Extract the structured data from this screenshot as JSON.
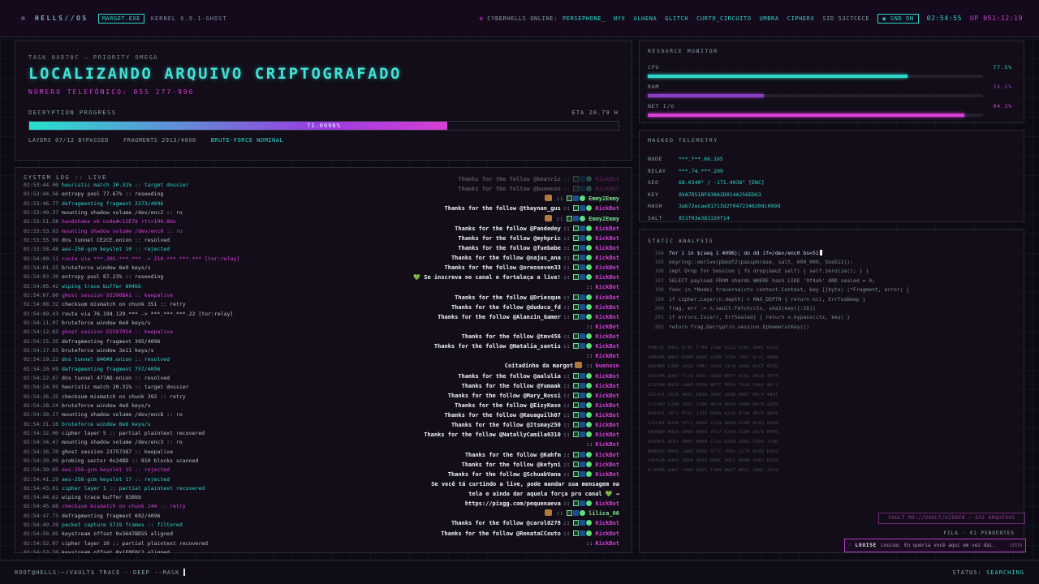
{
  "topbar": {
    "brand": "HELLS//OS",
    "tag": "MARGOT.EXE",
    "kernel": "KERNEL 6.9.1-GHOST",
    "online_label": "CYBERHELLS ONLINE:",
    "users": [
      "PERSEPHONE_",
      "NYX",
      "ALHENA",
      "GLITCH",
      "CURTO_CIRCUITO",
      "UMBRA",
      "CIPHERX"
    ],
    "sid": "SID 53C7CECE",
    "snd": "SND ON",
    "time": "02:54:55",
    "uptime": "UP 051:12:19"
  },
  "task": {
    "label": "TASK 0XD70C — PRIORITY OMEGA",
    "title": "LOCALIZANDO ARQUIVO CRIPTOGRAFADO",
    "phone": "NÚMERO TELEFÔNICO: 055 277-996",
    "progress_label": "DECRYPTION PROGRESS",
    "eta": "ETA 20.79 H",
    "progress": 0.71,
    "progress_text": "71.0096%",
    "layers": "LAYERS 07/12 BYPASSED",
    "fragments": "FRAGMENTS 2913/4096",
    "bruteforce": "BRUTE-FORCE NOMINAL"
  },
  "resources": {
    "title": "RESOURCE MONITOR",
    "items": [
      {
        "label": "CPU",
        "value": "77.5%",
        "fraction": 0.775,
        "color": "#2fd7c7"
      },
      {
        "label": "RAM",
        "value": "34.5%",
        "fraction": 0.345,
        "color": "#8b3fc0"
      },
      {
        "label": "NET I/O",
        "value": "94.3%",
        "fraction": 0.943,
        "color": "#d640d6"
      }
    ]
  },
  "telemetry": {
    "title": "MASKED TELEMETRY",
    "rows": [
      {
        "k": "NODE",
        "v": "***.***.66.165"
      },
      {
        "k": "RELAY",
        "v": "***.74.***.209"
      },
      {
        "k": "GEO",
        "v": "68.0340° / -171.4938° [ENC]"
      },
      {
        "k": "KEY",
        "v": "0XA7D51BF838A2D014A256ED63"
      },
      {
        "k": "HASH",
        "v": "3ab72ecae81713d2f047234620dc099d"
      },
      {
        "k": "SALT",
        "v": "851f03e381320f14"
      }
    ]
  },
  "analysis": {
    "title": "STATIC ANALYSIS",
    "code": [
      {
        "n": "194",
        "s": "for i in $(seq 1 4096); do dd if=/dev/enc0 bs=51",
        "hl": true
      },
      {
        "n": "195",
        "s": "keyring::derive(pbkdf2(passphrase, salt, 600_000, Sha512));"
      },
      {
        "n": "196",
        "s": "impl Drop for Session { fn drop(&mut self) { self.zeroize(); } }"
      },
      {
        "n": "197",
        "s": "SELECT payload FROM shards WHERE hash LIKE '9f4a%' AND sealed = 0;"
      },
      {
        "n": "198",
        "s": "func (n *Node) traverse(ctx context.Context, key []byte) (*Fragment, error) {"
      },
      {
        "n": "199",
        "s": "if cipher.Layer(n.depth) > MAX_DEPTH { return nil, ErrTooDeep }"
      },
      {
        "n": "200",
        "s": "frag, err := n.vault.Fetch(ctx, sha3(key)[:16])"
      },
      {
        "n": "201",
        "s": "if errors.Is(err, ErrSealed) { return n.bypass(ctx, key) }"
      },
      {
        "n": "202",
        "s": "return frag.Decrypt(n.session.EphemeralKey())"
      }
    ],
    "hex": [
      "994C1F b9e1 d747 f744 75ab 6c22 03b1 36ec e143",
      "34A48A 60e3 b990 ba0d 229d 1c0a f4e7 a77c 4668",
      "A658BA c3e0 342a 7d47 c9a4 11c8 3e6a d3cf 43fb",
      "56559A e56f f77d 8457 da6b b0ff dc82 2618 f9f4",
      "E32F64 8a29 1abd 9c66 a4ff 4056 fe2a 14e1 ae77",
      "282701 c639 ae02 b61e 36bc 1edb 48ef 0473 44df",
      "27c509 c2ad fb3c 3fd6 087a 903e 346d be7d 2ac9",
      "B55501 70f1 0f22 1732 ba45 a376 0756 4b19 ab01",
      "12CCB1 e33e 5f71 ab0e 752a aead 5c48 ecd3 e144",
      "E6D6D0 0858 a4e4 89ea 7937 9254 b1e6 3a7b 09fb",
      "9569F4 afb7 40df 00d4 cf2c d388 3865 f893 7c0b",
      "AD8D55 d095 1abd 036b 5ffc 2085 12f0 0c95 b562",
      "E8F82A ea03 3a54 861e ba0c adc1 8ee6 2563 bc03",
      "87399A ea8f 74a9 2e55 f38d d62f 002c 388c 12ca"
    ]
  },
  "vault": "VAULT MS://VAULT/HIDDEN — 032 ARQUIVOS",
  "fila": "FILA · 01 PENDENTES",
  "louise": {
    "name": "LOUISE",
    "message": "Louise: Eu queria você aqui em vez dai.",
    "state": "VISTO"
  },
  "syslog": {
    "title": "SYSTEM LOG :: LIVE",
    "rows": [
      {
        "t": "02:53:44.00",
        "m": "heuristic match 20.31% :: target dossier",
        "c": "cyan"
      },
      {
        "t": "02:53:44.56",
        "m": "entropy pool 77.67% :: reseeding",
        "c": "norm"
      },
      {
        "t": "02:53:46.77",
        "m": "defragmenting fragment 2373/4096",
        "c": "cyan"
      },
      {
        "t": "02:53:49.37",
        "m": "mounting shadow volume /dev/enc2 :: ro",
        "c": "norm"
      },
      {
        "t": "02:53:51.58",
        "m": "handshake ok node#c12E78 rtt=190.8ms",
        "c": "mag"
      },
      {
        "t": "02:53:53.93",
        "m": "mounting shadow volume /dev/enc0 :: ro",
        "c": "mag"
      },
      {
        "t": "02:53:55.99",
        "m": "dns tunnel CE2CE.onion :: resolved",
        "c": "norm"
      },
      {
        "t": "02:53:58.48",
        "m": "aes-256-gcm keyslot 10 :: rejected",
        "c": "cyan"
      },
      {
        "t": "02:54:00.11",
        "m": "route via ***.205.***.*** -> 210.***.***.*** [tor:relay]",
        "c": "mag"
      },
      {
        "t": "02:54:01.55",
        "m": "bruteforce window 8e9 keys/s",
        "c": "norm"
      },
      {
        "t": "02:54:03.39",
        "m": "entropy pool 87.23% :: reseeding",
        "c": "norm"
      },
      {
        "t": "02:54:05.42",
        "m": "wiping trace buffer 894kb",
        "c": "cyan"
      },
      {
        "t": "02:54:07.60",
        "m": "ghost session 93398BA1 :: keepalive",
        "c": "mag"
      },
      {
        "t": "02:54:08.32",
        "m": "checksum mismatch on chunk 351 :: retry",
        "c": "norm"
      },
      {
        "t": "02:54:09.43",
        "m": "route via 76.194.129.*** -> ***.***.***.22 [tor:relay]",
        "c": "norm"
      },
      {
        "t": "02:54:11.07",
        "m": "bruteforce window 6e8 keys/s",
        "c": "norm"
      },
      {
        "t": "02:54:12.83",
        "m": "ghost session E5597954 :: keepalive",
        "c": "mag"
      },
      {
        "t": "02:54:15.35",
        "m": "defragmenting fragment 395/4096",
        "c": "norm"
      },
      {
        "t": "02:54:17.85",
        "m": "bruteforce window 3e11 keys/s",
        "c": "norm"
      },
      {
        "t": "02:54:19.22",
        "m": "dns tunnel 840A9.onion :: resolved",
        "c": "cyan"
      },
      {
        "t": "02:54:20.69",
        "m": "defragmenting fragment 757/4096",
        "c": "cyan"
      },
      {
        "t": "02:54:22.87",
        "m": "dns tunnel 477AD.onion :: resolved",
        "c": "norm"
      },
      {
        "t": "02:54:24.95",
        "m": "heuristic match 20.31% :: target dossier",
        "c": "norm"
      },
      {
        "t": "02:54:26.35",
        "m": "checksum mismatch on chunk 392 :: retry",
        "c": "norm"
      },
      {
        "t": "02:54:28.24",
        "m": "bruteforce window 4e8 keys/s",
        "c": "norm"
      },
      {
        "t": "02:54:30.17",
        "m": "mounting shadow volume /dev/enc8 :: ro",
        "c": "norm"
      },
      {
        "t": "02:54:31.16",
        "m": "bruteforce window 8e6 keys/s",
        "c": "cyan"
      },
      {
        "t": "02:54:32.00",
        "m": "cipher layer 5 :: partial plaintext recovered",
        "c": "norm"
      },
      {
        "t": "02:54:34.47",
        "m": "mounting shadow volume /dev/enc3 :: ro",
        "c": "norm"
      },
      {
        "t": "02:54:36.70",
        "m": "ghost session 23757387 :: keepalive",
        "c": "norm"
      },
      {
        "t": "02:54:39.09",
        "m": "probing sector 0x248D :: 810 blocks scanned",
        "c": "norm"
      },
      {
        "t": "02:54:39.85",
        "m": "aes-256-gcm keyslot 15 :: rejected",
        "c": "mag"
      },
      {
        "t": "02:54:41.29",
        "m": "aes-256-gcm keyslot 17 :: rejected",
        "c": "cyan"
      },
      {
        "t": "02:54:43.01",
        "m": "cipher layer 1 :: partial plaintext recovered",
        "c": "cyan"
      },
      {
        "t": "02:54:44.62",
        "m": "wiping trace buffer 838kb",
        "c": "norm"
      },
      {
        "t": "02:54:45.68",
        "m": "checksum mismatch on chunk 244 :: retry",
        "c": "mag"
      },
      {
        "t": "02:54:47.73",
        "m": "defragmenting fragment 692/4096",
        "c": "norm"
      },
      {
        "t": "02:54:49.29",
        "m": "packet capture 5719 frames :: filtered",
        "c": "cyan"
      },
      {
        "t": "02:54:50.85",
        "m": "keystream offset 0x3647BD55 aligned",
        "c": "norm"
      },
      {
        "t": "02:54:52.07",
        "m": "cipher layer 10 :: partial plaintext recovered",
        "c": "norm"
      },
      {
        "t": "02:54:53.70",
        "m": "keystream offset 0x1F0E0C2 aligned",
        "c": "norm"
      }
    ]
  },
  "chat": {
    "rows": [
      {
        "text": "Thanks for the follow @beatriz",
        "user": "KickBot",
        "badges": true,
        "fade": true
      },
      {
        "text": "Thanks for the follow @buenosn",
        "user": "KickBot",
        "badges": true,
        "fade": true
      },
      {
        "text": "",
        "user": "Emmy2Emmy",
        "emoji": true,
        "green": true
      },
      {
        "text": "Thanks for the follow @thaynan_gus",
        "user": "KickBot",
        "badges": true
      },
      {
        "text": "",
        "user": "Emmy2Emmy",
        "emoji": true,
        "green": true
      },
      {
        "text": "Thanks for the follow @Pandedey",
        "user": "KickBot",
        "badges": true
      },
      {
        "text": "Thanks for the follow @myhpric",
        "user": "KickBot",
        "badges": true
      },
      {
        "text": "Thanks for the follow @fuebabe",
        "user": "KickBot",
        "badges": true
      },
      {
        "text": "Thanks for the follow @najux_ana",
        "user": "KickBot",
        "badges": true
      },
      {
        "text": "Thanks for the follow @oreoseven33",
        "user": "KickBot",
        "badges": true
      },
      {
        "text": "💚 Se inscreva no canal e fortaleça a live!",
        "user": "KickBot",
        "badges": true
      },
      {
        "text": "",
        "user": "KickBot"
      },
      {
        "text": "Thanks for the follow @Driesque",
        "user": "KickBot",
        "badges": true
      },
      {
        "text": "Thanks for the follow @duduca_fd",
        "user": "KickBot",
        "badges": true
      },
      {
        "text": "Thanks for the follow @Alanzin_Gamer",
        "user": "KickBot",
        "badges": true
      },
      {
        "text": "",
        "user": "KickBot"
      },
      {
        "text": "Thanks for the follow @tmv456",
        "user": "KickBot",
        "badges": true
      },
      {
        "text": "Thanks for the follow @Natalia_santis",
        "user": "KickBot",
        "badges": true
      },
      {
        "text": "",
        "user": "KickBot"
      },
      {
        "text": "Coitadinha da margot",
        "user": "buenosn",
        "emoji": true
      },
      {
        "text": "Thanks for the follow @aalulia",
        "user": "KickBot",
        "badges": true
      },
      {
        "text": "Thanks for the follow @Yumaak",
        "user": "KickBot",
        "badges": true
      },
      {
        "text": "Thanks for the follow @Mary_Rossi",
        "user": "KickBot",
        "badges": true
      },
      {
        "text": "Thanks for the follow @EizyKase",
        "user": "KickBot",
        "badges": true
      },
      {
        "text": "Thanks for the follow @Kauaguilh07",
        "user": "KickBot",
        "badges": true
      },
      {
        "text": "Thanks for the follow @Itsmay250",
        "user": "KickBot",
        "badges": true
      },
      {
        "text": "Thanks for the follow @NatallyCamila0310",
        "user": "KickBot",
        "badges": true
      },
      {
        "text": "",
        "user": "KickBot"
      },
      {
        "text": "Thanks for the follow @Kahfm",
        "user": "KickBot",
        "badges": true
      },
      {
        "text": "Thanks for the follow @kefyni",
        "user": "KickBot",
        "badges": true
      },
      {
        "text": "Thanks for the follow @SchuabVana",
        "user": "KickBot",
        "badges": true
      },
      {
        "text": "Se você tá curtindo a live, pode mandar sua mensagem na",
        "user": ""
      },
      {
        "text": "tela e ainda dar aquela força pro canal 💚 →",
        "user": ""
      },
      {
        "text": "https://pixgg.com/pequenaeva",
        "user": "KickBot",
        "badges": true
      },
      {
        "text": "",
        "user": "lilica_00",
        "emoji": true,
        "green": true
      },
      {
        "text": "Thanks for the follow @carol0278",
        "user": "KickBot",
        "badges": true
      },
      {
        "text": "Thanks for the follow @RenataCCouto",
        "user": "KickBot",
        "badges": true
      },
      {
        "text": "",
        "user": "KickBot"
      }
    ]
  },
  "bottom": {
    "prompt": "ROOT@HELLS:~/VAULT$ TRACE --DEEP --MASK",
    "status_label": "STATUS:",
    "status_value": "SEARCHING"
  }
}
